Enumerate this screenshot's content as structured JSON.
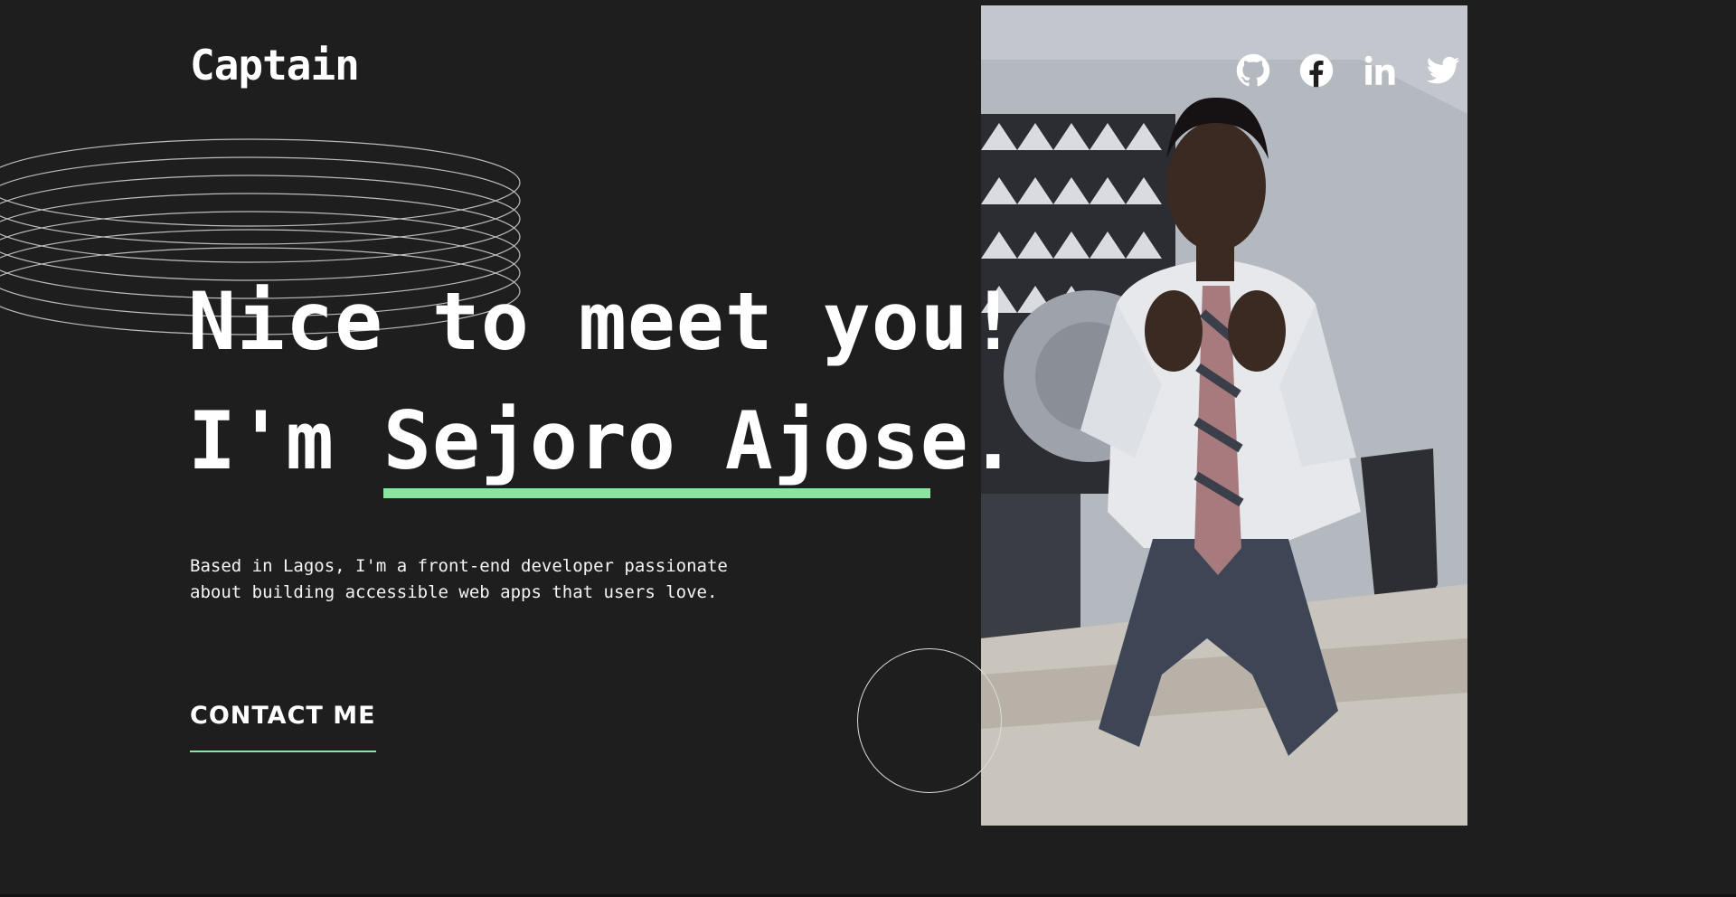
{
  "header": {
    "logo_text": "Captain"
  },
  "socials": [
    {
      "icon": "github-icon"
    },
    {
      "icon": "facebook-icon"
    },
    {
      "icon": "linkedin-icon"
    },
    {
      "icon": "twitter-icon"
    }
  ],
  "hero": {
    "line1": "Nice to meet you!",
    "line2_prefix": "I'm ",
    "name": "Sejoro Ajose.",
    "intro": "Based in Lagos, I'm a front-end developer passionate about building accessible web apps that users love.",
    "contact_label": "CONTACT ME"
  },
  "colors": {
    "background": "#1e1e1e",
    "accent": "#8fe3a0",
    "text": "#ffffff"
  }
}
